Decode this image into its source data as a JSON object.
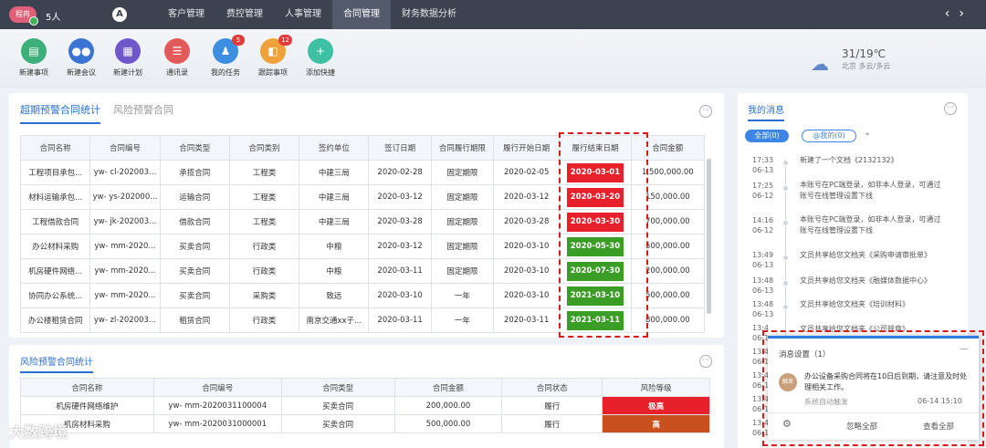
{
  "topbar": {
    "avatar_text": "程冉",
    "user_count": "5人",
    "logo": "A",
    "nav": [
      "客户管理",
      "费控管理",
      "人事管理",
      "合同管理",
      "财务数据分析"
    ],
    "arrow_prev": "‹",
    "arrow_next": "›"
  },
  "quick": [
    {
      "label": "新建事项",
      "icon": "▤",
      "color": "#3db07a",
      "badge": ""
    },
    {
      "label": "新建会议",
      "icon": "●●",
      "color": "#3b74d4",
      "badge": ""
    },
    {
      "label": "新建计划",
      "icon": "▦",
      "color": "#6e57c9",
      "badge": ""
    },
    {
      "label": "通讯录",
      "icon": "☰",
      "color": "#e25a5a",
      "badge": ""
    },
    {
      "label": "我的任务",
      "icon": "♟",
      "color": "#3b8ee0",
      "badge": "5"
    },
    {
      "label": "跟踪事项",
      "icon": "◧",
      "color": "#f0a23a",
      "badge": "12"
    },
    {
      "label": "添加快捷",
      "icon": "+",
      "color": "#3dc0a4",
      "badge": ""
    }
  ],
  "weather": {
    "temp": "31/19℃",
    "desc": "北京 多云/多云"
  },
  "overdue": {
    "tabs": [
      "超期预警合同统计",
      "风险预警合同"
    ],
    "more": "···",
    "columns": [
      "合同名称",
      "合同编号",
      "合同类型",
      "合同类别",
      "签约单位",
      "签订日期",
      "合同履行期限",
      "履行开始日期",
      "履行结束日期",
      "合同金额"
    ],
    "rows": [
      [
        "工程项目承包...",
        "yw- cl-202003...",
        "承揽合同",
        "工程类",
        "中建三局",
        "2020-02-28",
        "固定期限",
        "2020-02-05",
        "2020-03-01",
        "1,500,000.00",
        "red"
      ],
      [
        "材料运输承包...",
        "yw- ys-202000...",
        "运输合同",
        "工程类",
        "中建三局",
        "2020-03-12",
        "固定期限",
        "2020-03-12",
        "2020-03-20",
        "150,000.00",
        "red"
      ],
      [
        "工程借款合同",
        "yw- jk-202003...",
        "借款合同",
        "工程类",
        "中建三局",
        "2020-03-28",
        "固定期限",
        "2020-03-28",
        "2020-03-30",
        "700,000.00",
        "red"
      ],
      [
        "办公材料采购",
        "yw- mm-2020...",
        "买卖合同",
        "行政类",
        "中粮",
        "2020-03-12",
        "固定期限",
        "2020-03-10",
        "2020-05-30",
        "500,000.00",
        "green"
      ],
      [
        "机房硬件网络...",
        "yw- mm-2020...",
        "买卖合同",
        "行政类",
        "中粮",
        "2020-03-11",
        "固定期限",
        "2020-03-10",
        "2020-07-30",
        "200,000.00",
        "green"
      ],
      [
        "协同办公系统...",
        "yw- mm-2020...",
        "买卖合同",
        "采购类",
        "致远",
        "2020-03-10",
        "一年",
        "2020-03-10",
        "2021-03-10",
        "500,000.00",
        "green"
      ],
      [
        "办公楼租赁合同",
        "yw- zl-202003...",
        "租赁合同",
        "行政类",
        "南京交通xx子...",
        "2020-03-11",
        "一年",
        "2020-03-11",
        "2021-03-11",
        "800,000.00",
        "green"
      ]
    ]
  },
  "risk": {
    "title": "风险预警合同统计",
    "more": "···",
    "columns": [
      "合同名称",
      "合同编号",
      "合同类型",
      "合同金额",
      "合同状态",
      "风险等级"
    ],
    "rows": [
      [
        "机房硬件网络维护",
        "yw- mm-2020031100004",
        "买卖合同",
        "200,000.00",
        "履行",
        "极高",
        "#e8202c"
      ],
      [
        "机房材料采购",
        "yw- mm-2020031000001",
        "买卖合同",
        "500,000.00",
        "履行",
        "高",
        "#c8501e"
      ]
    ]
  },
  "messages": {
    "title": "我的消息",
    "more": "···",
    "filter_all": "全部(0)",
    "filter_at": "@我的(0)",
    "chevron": "⌄",
    "items": [
      {
        "time": "17:33",
        "date": "06-13",
        "text": "新建了一个文档《2132132》"
      },
      {
        "time": "17:25",
        "date": "06-12",
        "text": "本账号在PC端登录，如非本人登录，可通过账号在线管理设置下线"
      },
      {
        "time": "14:16",
        "date": "06-12",
        "text": "本账号在PC端登录，如非本人登录，可通过账号在线管理设置下线"
      },
      {
        "time": "13:49",
        "date": "06-13",
        "text": "文员共享给您文档夹《采购申请审批单》"
      },
      {
        "time": "13:48",
        "date": "06-13",
        "text": "文员共享给您文档夹《融媒体数据中心》"
      },
      {
        "time": "13:48",
        "date": "06-13",
        "text": "文员共享给您文档夹《培训材料》"
      },
      {
        "time": "13:4",
        "date": "06-1",
        "text": "文员共享给您文档夹《公司规章》"
      }
    ]
  },
  "popup": {
    "title": "消息设置（1）",
    "minimize": "—",
    "sender_avatar": "触发",
    "content": "办公设备采购合同将在10日后到期，请注意及时处理相关工作。",
    "source": "系统自动触发",
    "time": "06-14 15:10",
    "gear": "⚙",
    "ignore_all": "忽略全部",
    "view_all": "查看全部",
    "left_times": [
      "13:4",
      "06-1",
      "13:4",
      "06-1",
      "13:4",
      "06-1",
      "13:4",
      "06-1"
    ]
  },
  "watermark": "大数跨境"
}
